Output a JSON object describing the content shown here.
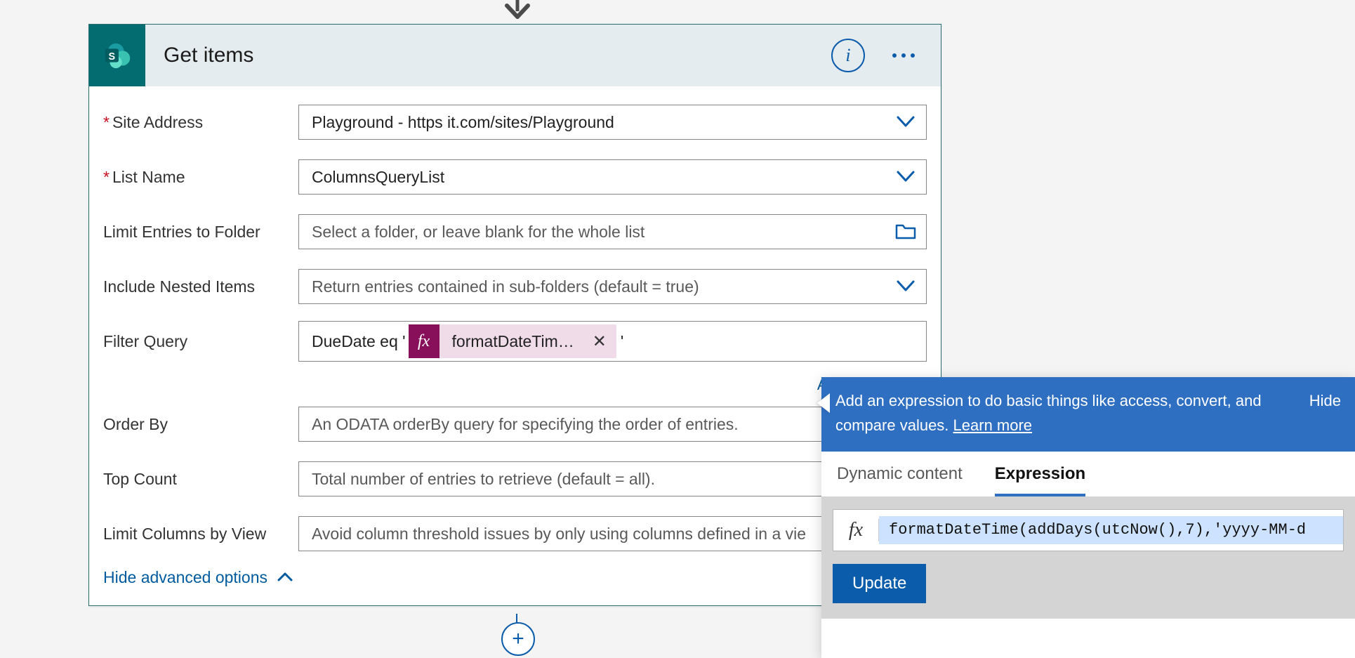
{
  "card": {
    "title": "Get items",
    "fields": {
      "site_address": {
        "label": "Site Address",
        "required": true,
        "value": "Playground - https                              it.com/sites/Playground"
      },
      "list_name": {
        "label": "List Name",
        "required": true,
        "value": "ColumnsQueryList"
      },
      "limit_folder": {
        "label": "Limit Entries to Folder",
        "placeholder": "Select a folder, or leave blank for the whole list"
      },
      "include_nested": {
        "label": "Include Nested Items",
        "placeholder": "Return entries contained in sub-folders (default = true)"
      },
      "filter_query": {
        "label": "Filter Query",
        "prefix": "DueDate eq '",
        "token": "formatDateTim…",
        "token_icon": "fx",
        "suffix": "'"
      },
      "order_by": {
        "label": "Order By",
        "placeholder": "An ODATA orderBy query for specifying the order of entries."
      },
      "top_count": {
        "label": "Top Count",
        "placeholder": "Total number of entries to retrieve (default = all)."
      },
      "limit_cols": {
        "label": "Limit Columns by View",
        "placeholder": "Avoid column threshold issues by only using columns defined in a vie"
      }
    },
    "add_dynamic_label": "Add dynami",
    "hide_advanced_label": "Hide advanced options"
  },
  "panel": {
    "help_text": "Add an expression to do basic things like access, convert, and compare values. ",
    "learn_more": "Learn more",
    "hide_label": "Hide",
    "tabs": {
      "dynamic": "Dynamic content",
      "expression": "Expression"
    },
    "fx_label": "fx",
    "expression_value": "formatDateTime(addDays(utcNow(),7),'yyyy-MM-d",
    "update_label": "Update"
  }
}
